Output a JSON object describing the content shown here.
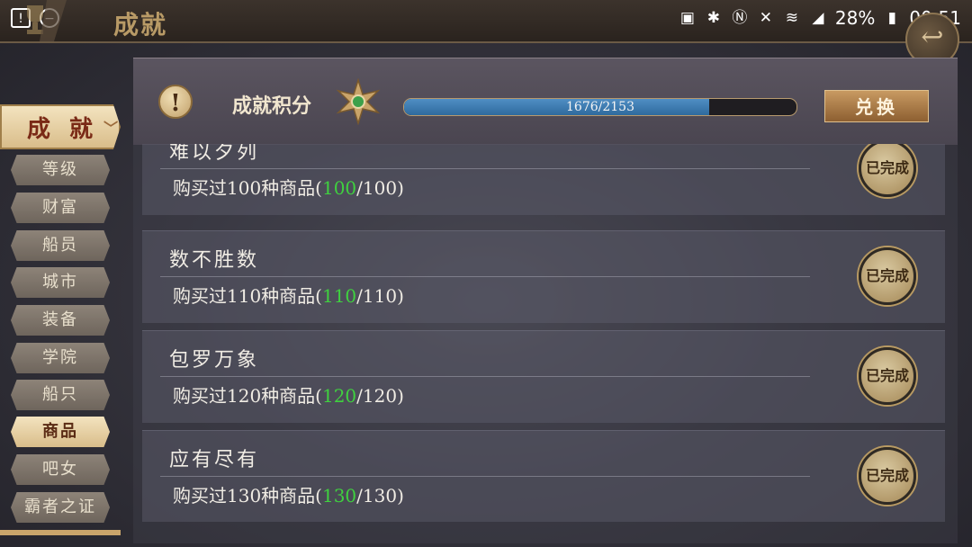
{
  "status_bar": {
    "left_icons": [
      "alert-icon",
      "minus-circle-icon"
    ],
    "right_icons": [
      "sim-icon",
      "bluetooth-icon",
      "nfc-icon",
      "mute-icon",
      "wifi-icon",
      "signal-icon"
    ],
    "battery": "28%",
    "time": "00:51"
  },
  "header": {
    "title": "成就"
  },
  "sidebar": {
    "main": {
      "label": "成 就"
    },
    "items": [
      {
        "label": "等级"
      },
      {
        "label": "财富"
      },
      {
        "label": "船员"
      },
      {
        "label": "城市"
      },
      {
        "label": "装备"
      },
      {
        "label": "学院"
      },
      {
        "label": "船只"
      },
      {
        "label": "商品",
        "active": true
      },
      {
        "label": "吧女"
      },
      {
        "label": "霸者之证"
      }
    ]
  },
  "score": {
    "label": "成就积分",
    "progress_text": "1676/2153",
    "current": 1676,
    "total": 2153,
    "exchange_label": "兑换"
  },
  "achievements": [
    {
      "title": "难以夕列",
      "desc_prefix": "购买过100种商品(",
      "current": "100",
      "desc_suffix": "/100)",
      "badge": "已完成"
    },
    {
      "title": "数不胜数",
      "desc_prefix": "购买过110种商品(",
      "current": "110",
      "desc_suffix": "/110)",
      "badge": "已完成"
    },
    {
      "title": "包罗万象",
      "desc_prefix": "购买过120种商品(",
      "current": "120",
      "desc_suffix": "/120)",
      "badge": "已完成"
    },
    {
      "title": "应有尽有",
      "desc_prefix": "购买过130种商品(",
      "current": "130",
      "desc_suffix": "/130)",
      "badge": "已完成"
    }
  ],
  "colors": {
    "accent_gold": "#c89a62",
    "progress_blue": "#3f7fb5",
    "complete_green": "#3fd13f"
  }
}
